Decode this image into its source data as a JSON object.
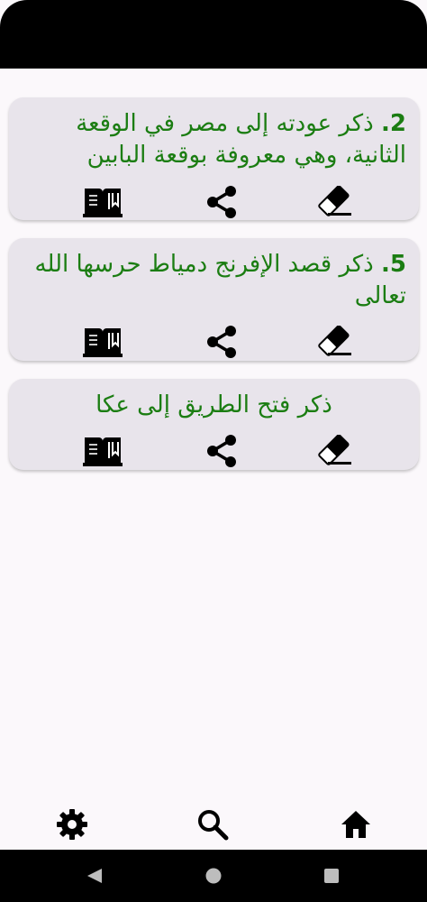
{
  "colors": {
    "title_green": "#1b7d12",
    "card_bg": "#e8e4eb",
    "page_bg": "#fbf8fb"
  },
  "cards": [
    {
      "number": "2.",
      "title": "ذكر عودته إلى مصر في الوقعة الثانية، وهي معروفة بوقعة البابين",
      "icons": [
        "book-icon",
        "share-icon",
        "eraser-icon"
      ]
    },
    {
      "number": "5.",
      "title": "ذكر قصد الإفرنج دمياط حرسها الله تعالى",
      "icons": [
        "book-icon",
        "share-icon",
        "eraser-icon"
      ]
    },
    {
      "number": "",
      "title": "ذكر فتح الطريق إلى عكا",
      "icons": [
        "book-icon",
        "share-icon",
        "eraser-icon"
      ]
    }
  ],
  "bottom_nav": {
    "items": [
      "settings-icon",
      "search-icon",
      "home-icon"
    ]
  },
  "system_nav": {
    "items": [
      "back-icon",
      "home-circle-icon",
      "recents-icon"
    ]
  }
}
